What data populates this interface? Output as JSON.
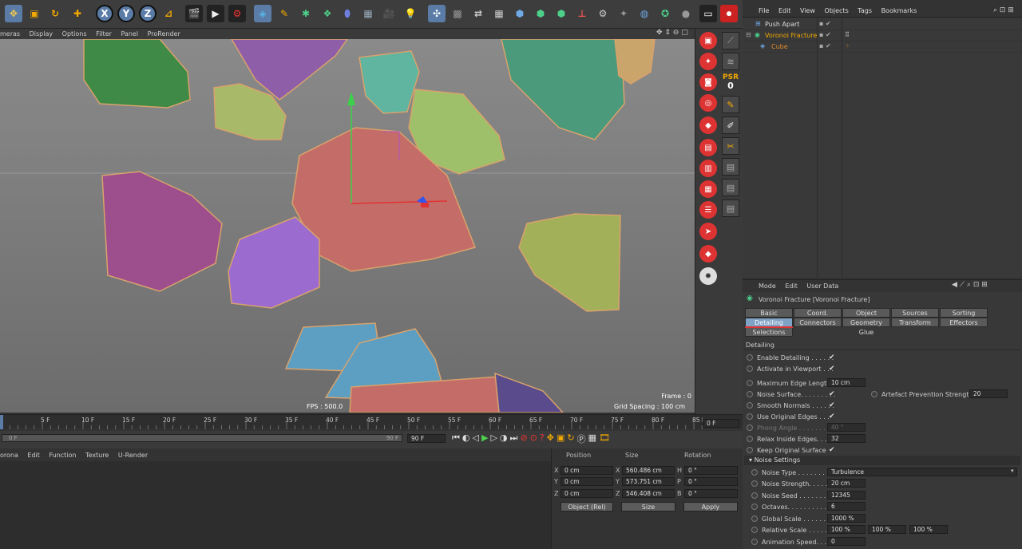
{
  "toolbar": {
    "axis_buttons": [
      "X",
      "Y",
      "Z"
    ],
    "icons": [
      "move-icon",
      "scale-icon",
      "rotate-icon",
      "add-icon",
      "x-axis-icon",
      "y-axis-icon",
      "z-axis-icon",
      "coordinate-system-icon",
      "render-view-icon",
      "render-picture-queue-icon",
      "render-settings-icon",
      "cube-icon",
      "pen-icon",
      "subdivision-icon",
      "array-icon",
      "deformer-icon",
      "floor-icon",
      "camera-icon",
      "light-icon"
    ]
  },
  "viewport": {
    "menu": [
      "meras",
      "Display",
      "Options",
      "Filter",
      "Panel",
      "ProRender"
    ],
    "fps": "FPS : 500.0",
    "frame": "Frame : 0",
    "grid_spacing": "Grid Spacing : 100 cm"
  },
  "timeline": {
    "ticks": [
      "5 F",
      "10 F",
      "15 F",
      "20 F",
      "25 F",
      "30 F",
      "35 F",
      "40 F",
      "45 F",
      "50 F",
      "55 F",
      "60 F",
      "65 F",
      "70 F",
      "75 F",
      "80 F",
      "85 F",
      "90 F"
    ],
    "current_frame": "0 F",
    "range_start": "0 F",
    "range_end": "90 F",
    "end_field": "90 F"
  },
  "material_manager": {
    "menu": [
      "orona",
      "Edit",
      "Function",
      "Texture",
      "U-Render"
    ]
  },
  "coordinates": {
    "headers": [
      "Position",
      "Size",
      "Rotation"
    ],
    "rows": [
      {
        "axis": "X",
        "pos": "0 cm",
        "size_axis": "X",
        "size": "560.486 cm",
        "rot_axis": "H",
        "rot": "0 °"
      },
      {
        "axis": "Y",
        "pos": "0 cm",
        "size_axis": "Y",
        "size": "573.751 cm",
        "rot_axis": "P",
        "rot": "0 °"
      },
      {
        "axis": "Z",
        "pos": "0 cm",
        "size_axis": "Z",
        "size": "546.408 cm",
        "rot_axis": "B",
        "rot": "0 °"
      }
    ],
    "mode_select": "Object (Rel)",
    "size_select": "Size",
    "apply": "Apply"
  },
  "object_manager": {
    "menu": [
      "File",
      "Edit",
      "View",
      "Objects",
      "Tags",
      "Bookmarks"
    ],
    "items": [
      {
        "name": "Push Apart",
        "indent": 0
      },
      {
        "name": "Voronoi Fracture",
        "indent": 0
      },
      {
        "name": "Cube",
        "indent": 1
      }
    ]
  },
  "attributes": {
    "menu": [
      "Mode",
      "Edit",
      "User Data"
    ],
    "title": "Voronoi Fracture [Voronoi Fracture]",
    "tabs_row1": [
      "Basic",
      "Coord.",
      "Object",
      "Sources",
      "Sorting"
    ],
    "tabs_row2": [
      "Detailing",
      "Connectors",
      "Geometry Glue",
      "Transform",
      "Effectors"
    ],
    "tabs_row3": [
      "Selections"
    ],
    "active_tab": "Detailing",
    "section": "Detailing",
    "enable_detailing": "Enable Detailing . . . . . .",
    "activate_in_viewport": "Activate in Viewport . . .",
    "max_edge_length_label": "Maximum Edge Length",
    "max_edge_length": "10 cm",
    "noise_surface": "Noise Surface. . . . . . . . .",
    "artefact_label": "Artefact Prevention Strength",
    "artefact_value": "20",
    "smooth_normals": "Smooth Normals . . . . . .",
    "use_original_edges": "Use Original Edges . . .",
    "phong_angle_label": "Phong Angle . . . . . . . . .",
    "phong_angle": "40 °",
    "relax_inside_edges_label": "Relax Inside Edges. . . .",
    "relax_inside_edges": "32",
    "keep_original_surface": "Keep Original Surface",
    "noise_settings": "Noise Settings",
    "noise_type_label": "Noise Type . . . . . . . .",
    "noise_type": "Turbulence",
    "noise_strength_label": "Noise Strength. . . . .",
    "noise_strength": "20 cm",
    "noise_seed_label": "Noise Seed . . . . . . . .",
    "noise_seed": "12345",
    "octaves_label": "Octaves. . . . . . . . . . .",
    "octaves": "6",
    "global_scale_label": "Global Scale . . . . . . .",
    "global_scale": "1000 %",
    "relative_scale_label": "Relative Scale . . . . . .",
    "relative_scale": [
      "100 %",
      "100 %",
      "100 %"
    ],
    "animation_speed_label": "Animation Speed. . . .",
    "animation_speed": "0"
  },
  "side_palette": {
    "psr_label": "PSR",
    "psr_value": "0"
  }
}
